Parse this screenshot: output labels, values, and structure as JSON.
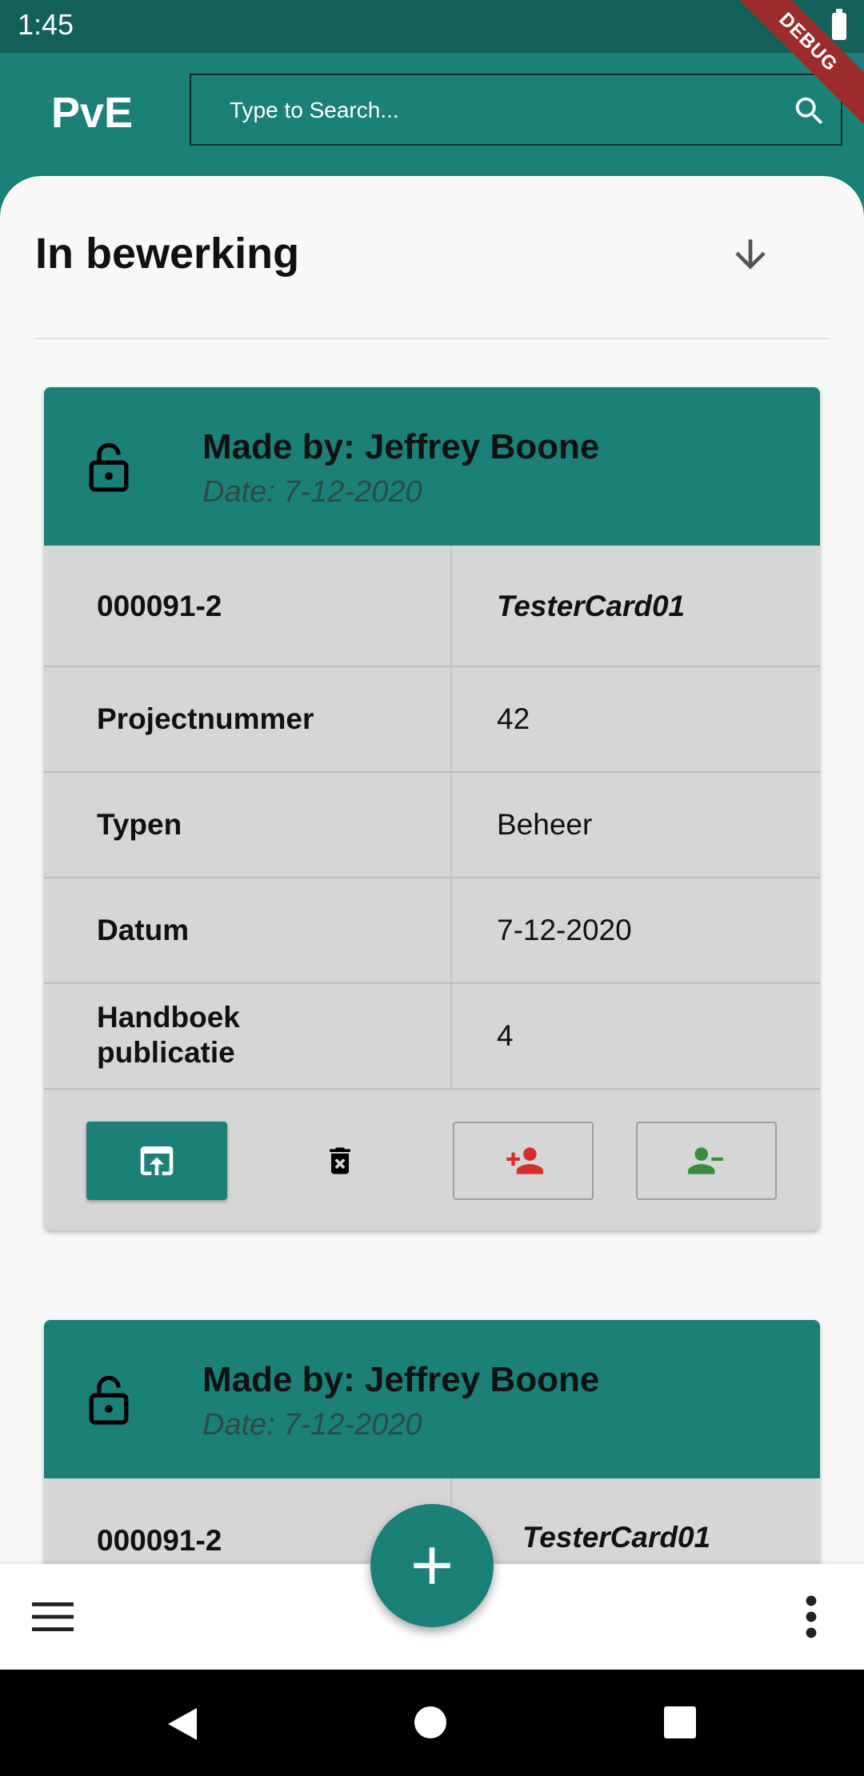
{
  "status_bar": {
    "time": "1:45"
  },
  "debug_banner": "DEBUG",
  "app_bar": {
    "logo": "PvE",
    "search": {
      "placeholder": "Type to Search...",
      "value": ""
    }
  },
  "section": {
    "title": "In bewerking"
  },
  "cards": [
    {
      "made_by": "Made by: Jeffrey Boone",
      "date": "Date: 7-12-2020",
      "id_label": "000091-2",
      "id_value": "TesterCard01",
      "rows": [
        {
          "label": "Projectnummer",
          "value": "42"
        },
        {
          "label": "Typen",
          "value": "Beheer"
        },
        {
          "label": "Datum",
          "value": "7-12-2020"
        },
        {
          "label": "Handboek publicatie",
          "value": "4"
        }
      ],
      "actions": [
        {
          "icon": "open-in-browser-icon"
        },
        {
          "icon": "delete-forever-icon"
        },
        {
          "icon": "person-add-icon",
          "color": "#d32f2f"
        },
        {
          "icon": "person-remove-icon",
          "color": "#388e3c"
        }
      ]
    },
    {
      "made_by": "Made by: Jeffrey Boone",
      "date": "Date: 7-12-2020",
      "id_label": "000091-2",
      "id_value": "TesterCard01"
    }
  ],
  "colors": {
    "primary": "#1a8078",
    "status_bar": "#135f59",
    "card_bg": "#d6d6d6",
    "add_user": "#d32f2f",
    "remove_user": "#388e3c"
  }
}
